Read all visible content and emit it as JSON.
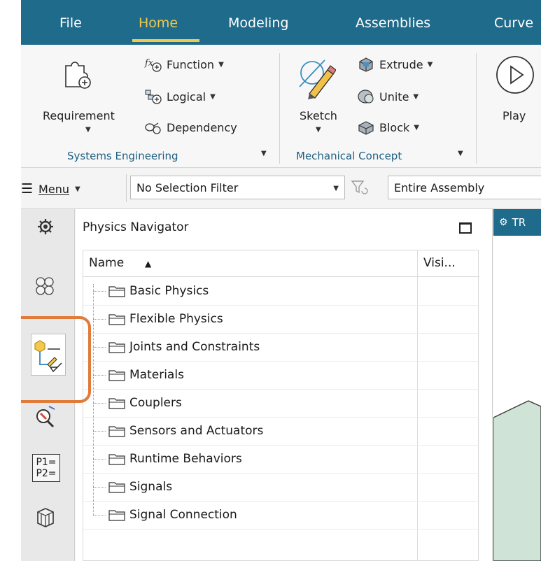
{
  "menu_tabs": [
    {
      "label": "File"
    },
    {
      "label": "Home"
    },
    {
      "label": "Modeling"
    },
    {
      "label": "Assemblies"
    },
    {
      "label": "Curve"
    }
  ],
  "ribbon": {
    "requirement": "Requirement",
    "function": "Function",
    "logical": "Logical",
    "dependency": "Dependency",
    "sketch": "Sketch",
    "extrude": "Extrude",
    "unite": "Unite",
    "block": "Block",
    "play": "Play",
    "group_systems": "Systems Engineering",
    "group_mechanical": "Mechanical Concept"
  },
  "toolbar": {
    "menu_label": "Menu",
    "selection_filter": "No Selection Filter",
    "scope": "Entire Assembly"
  },
  "navigator": {
    "title": "Physics Navigator",
    "columns": [
      "Name",
      "Visi..."
    ],
    "items": [
      "Basic Physics",
      "Flexible Physics",
      "Joints and Constraints",
      "Materials",
      "Couplers",
      "Sensors and Actuators",
      "Runtime Behaviors",
      "Signals",
      "Signal Connection"
    ]
  },
  "resource_bar": {
    "icons": [
      "settings-gear-icon",
      "assembly-navigator-icon",
      "physics-navigator-icon",
      "inspect-icon",
      "parameters-icon",
      "part-cube-icon"
    ],
    "p_label_1": "P1=",
    "p_label_2": "P2="
  },
  "graphics": {
    "tab_label": "TR"
  },
  "colors": {
    "tab_bar": "#1f6b8b",
    "active_tab": "#f2c94c",
    "highlight": "#e07b39",
    "group_label": "#1f5f80"
  }
}
